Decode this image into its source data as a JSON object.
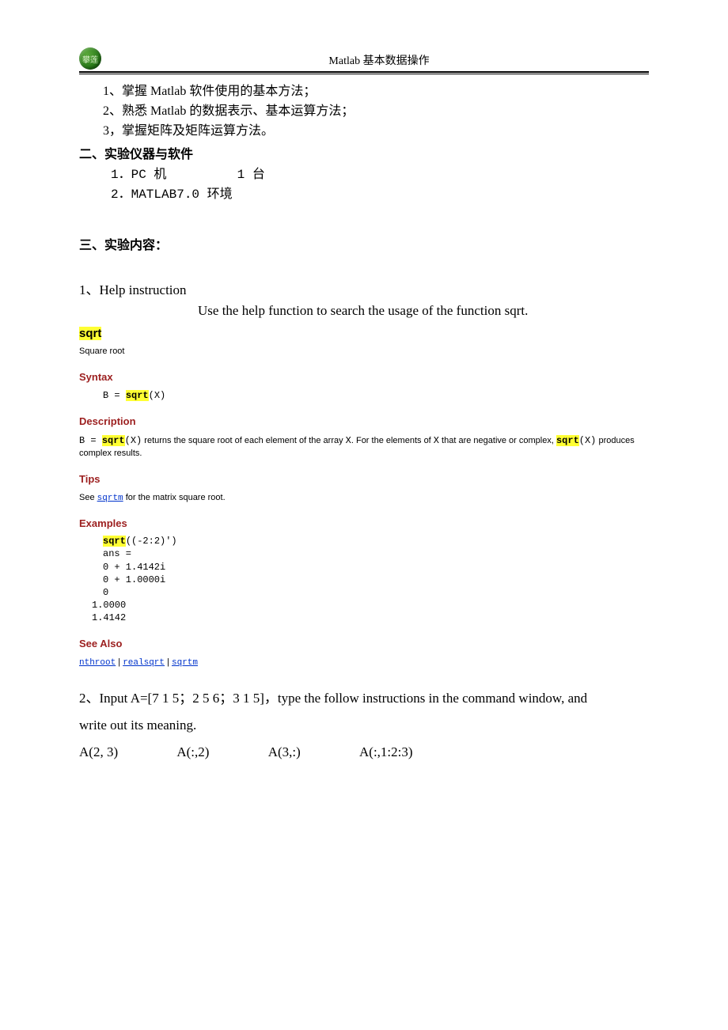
{
  "header": {
    "logo_text": "攀莲",
    "title": "Matlab 基本数据操作"
  },
  "goals": {
    "g1": "1、掌握 Matlab 软件使用的基本方法；",
    "g2": "2、熟悉 Matlab 的数据表示、基本运算方法；",
    "g3": "3，掌握矩阵及矩阵运算方法。"
  },
  "section2": {
    "head": "二、实验仪器与软件",
    "item1_label": "1．PC 机",
    "item1_qty": "1 台",
    "item2": "2．MATLAB7.0 环境"
  },
  "section3": {
    "head": "三、实验内容："
  },
  "q1": {
    "title": "1、Help instruction",
    "instruction": "Use the help function to search the usage of the function sqrt."
  },
  "doc": {
    "fn_name": "sqrt",
    "subtitle": "Square root",
    "syntax_head": "Syntax",
    "syntax_pre": "B = ",
    "syntax_fn": "sqrt",
    "syntax_post": "(X)",
    "desc_head": "Description",
    "desc_pre": "B = ",
    "desc_fn": "sqrt",
    "desc_mid1": "(X)",
    "desc_text1": " returns the square root of each element of the array ",
    "desc_x1": "X",
    "desc_text2": ". For the elements of ",
    "desc_x2": "X",
    "desc_text3": " that are negative or complex, ",
    "desc_fn2": "sqrt",
    "desc_post2": "(X)",
    "desc_text4": " produces complex results.",
    "tips_head": "Tips",
    "tips_pre": "See ",
    "tips_link": "sqrtm",
    "tips_post": " for the matrix square root.",
    "ex_head": "Examples",
    "ex_fn": "sqrt",
    "ex_arg": "((-2:2)')",
    "ex_lines": {
      "l1": "ans =",
      "l2": "     0 + 1.4142i",
      "l3": "     0 + 1.0000i",
      "l4": "     0",
      "l5": "1.0000",
      "l6": "1.4142"
    },
    "see_head": "See Also",
    "see1": "nthroot",
    "sep": " | ",
    "see2": "realsqrt",
    "see3": "sqrtm"
  },
  "q2": {
    "line1": "2、Input A=[7   1   5；2   5   6；3   1   5]，type the follow instructions in the command window, and",
    "line2": "write out its meaning.",
    "a1": "A(2, 3)",
    "a2": "A(:,2)",
    "a3": "A(3,:)",
    "a4": "A(:,1:2:3)"
  }
}
